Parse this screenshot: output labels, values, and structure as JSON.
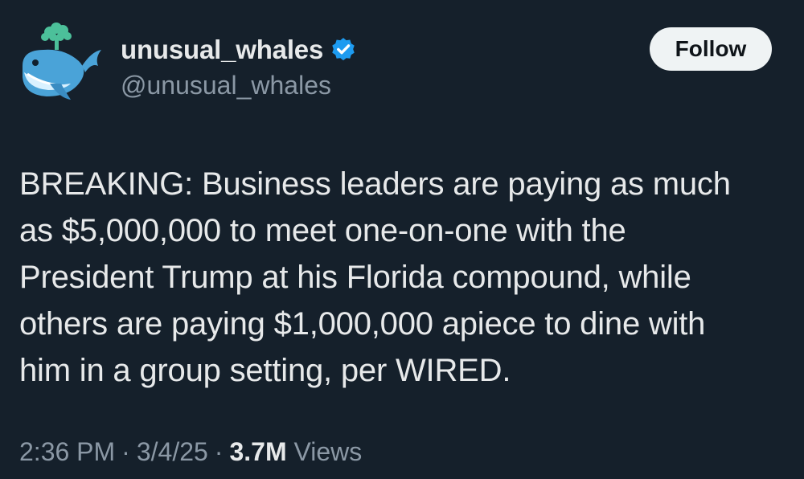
{
  "author": {
    "display_name": "unusual_whales",
    "handle": "@unusual_whales",
    "verified": true,
    "verified_color": "#1d9bf0"
  },
  "follow_button": {
    "label": "Follow"
  },
  "tweet": {
    "lines": [
      "BREAKING: Business leaders are paying as much",
      "as $5,000,000 to meet one-on-one with the",
      "President Trump at his Florida compound, while",
      "others are paying $1,000,000 apiece to dine with",
      "him in a group setting, per WIRED."
    ]
  },
  "meta": {
    "time": "2:36 PM",
    "date": "3/4/25",
    "separator": "·",
    "views_count": "3.7M",
    "views_label": "Views"
  },
  "colors": {
    "background": "#15202b",
    "text_primary": "#e7e9ea",
    "text_secondary": "#8b98a5",
    "button_bg": "#eff3f4"
  }
}
